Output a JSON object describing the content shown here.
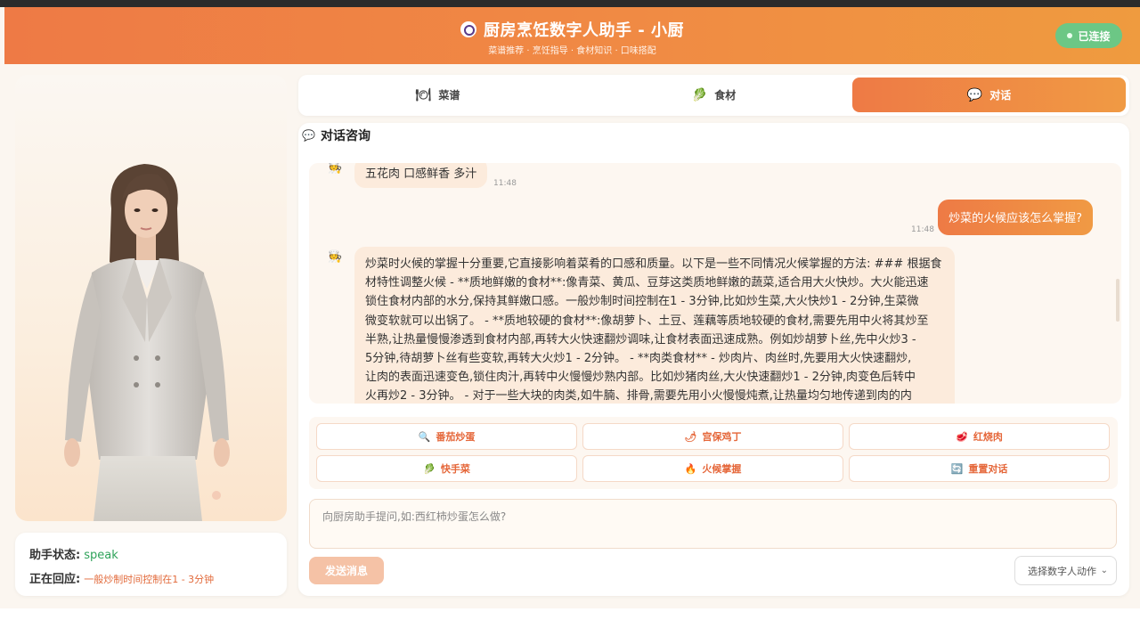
{
  "header": {
    "title": "厨房烹饪数字人助手 - 小厨",
    "subtitle": "菜谱推荐 · 烹饪指导 · 食材知识 · 口味搭配",
    "connection_status": "已连接"
  },
  "status_card": {
    "state_label": "助手状态:",
    "state_value": "speak",
    "reply_label": "正在回应:",
    "reply_value": "一般炒制时间控制在1 - 3分钟"
  },
  "tabs": [
    {
      "label": "菜谱",
      "icon": "plate-icon"
    },
    {
      "label": "食材",
      "icon": "vegetable-icon"
    },
    {
      "label": "对话",
      "icon": "speech-bubble-icon",
      "active": true
    }
  ],
  "chat": {
    "title": "对话咨询",
    "messages": [
      {
        "role": "assistant",
        "text": "五花肉 口感鲜香 多汁",
        "time": "11:48"
      },
      {
        "role": "user",
        "text": "炒菜的火候应该怎么掌握?",
        "time": "11:48"
      },
      {
        "role": "assistant",
        "lines": [
          "炒菜时火候的掌握十分重要,它直接影响着菜肴的口感和质量。以下是一些不同情况火候掌握的方法: ### 根据食",
          "材特性调整火候 - **质地鲜嫩的食材**:像青菜、黄瓜、豆芽这类质地鲜嫩的蔬菜,适合用大火快炒。大火能迅速",
          "锁住食材内部的水分,保持其鲜嫩口感。一般炒制时间控制在1 - 3分钟,比如炒生菜,大火快炒1 - 2分钟,生菜微",
          "微变软就可以出锅了。 - **质地较硬的食材**:像胡萝卜、土豆、莲藕等质地较硬的食材,需要先用中火将其炒至",
          "半熟,让热量慢慢渗透到食材内部,再转大火快速翻炒调味,让食材表面迅速成熟。例如炒胡萝卜丝,先中火炒3 -",
          "5分钟,待胡萝卜丝有些变软,再转大火炒1 - 2分钟。 - **肉类食材** - 炒肉片、肉丝时,先要用大火快速翻炒,",
          "让肉的表面迅速变色,锁住肉汁,再转中火慢慢炒熟内部。比如炒猪肉丝,大火快速翻炒1 - 2分钟,肉变色后转中",
          "火再炒2 - 3分钟。 - 对于一些大块的肉类,如牛腩、排骨,需要先用小火慢慢炖煮,让热量均匀地传递到肉的内"
        ]
      }
    ]
  },
  "quick_actions": [
    {
      "label": "番茄炒蛋",
      "icon": "magnifier-icon"
    },
    {
      "label": "宫保鸡丁",
      "icon": "chili-icon"
    },
    {
      "label": "红烧肉",
      "icon": "meat-icon"
    },
    {
      "label": "快手菜",
      "icon": "vegetable-icon"
    },
    {
      "label": "火候掌握",
      "icon": "fire-icon"
    },
    {
      "label": "重置对话",
      "icon": "reset-icon"
    }
  ],
  "input": {
    "placeholder": "向厨房助手提问,如:西红柿炒蛋怎么做?"
  },
  "send_label": "发送消息",
  "action_select": {
    "selected": "选择数字人动作"
  },
  "colors": {
    "accent": "#ee7a45",
    "accent_end": "#f09a44",
    "connected": "#6cc785",
    "state_value": "#2fa35a"
  }
}
